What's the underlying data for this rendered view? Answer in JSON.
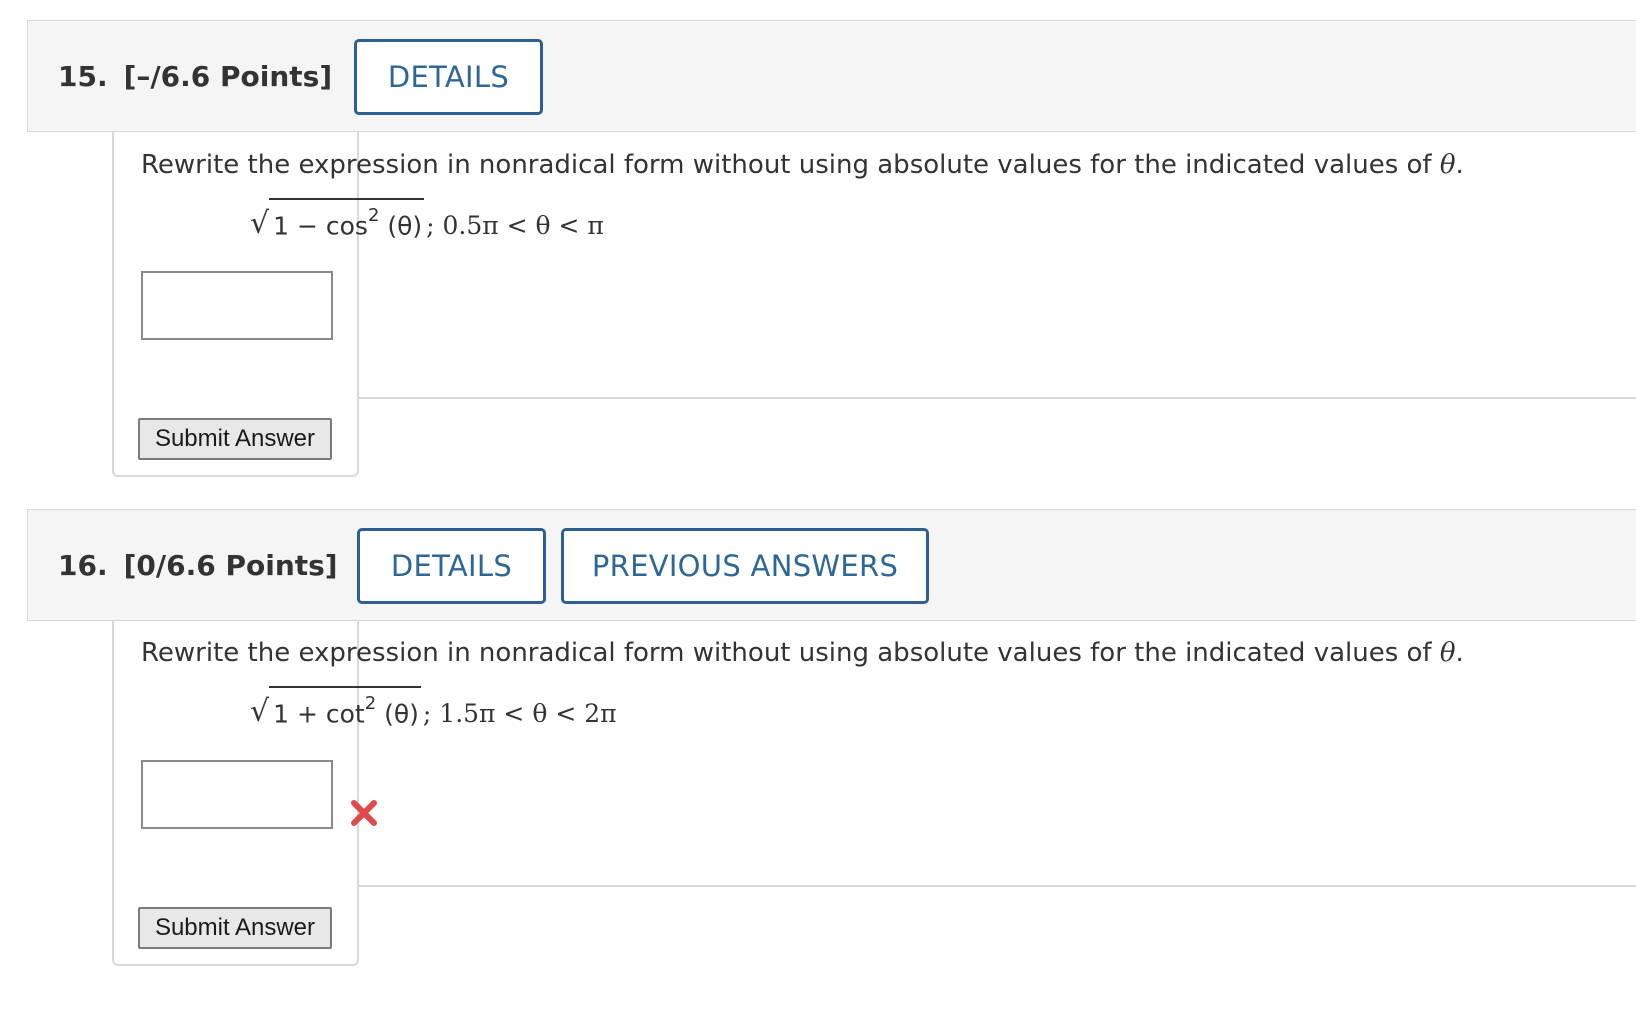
{
  "questions": [
    {
      "number": "15.",
      "points": "[–/6.6 Points]",
      "details_label": "DETAILS",
      "prompt_text": "Rewrite the expression in nonradical form without using absolute values for the indicated values of ",
      "theta": "θ",
      "prompt_end": ".",
      "radicand_lead": "1 − cos",
      "exponent": "2",
      "radicand_tail": " (θ)",
      "constraint": "; 0.5π < θ < π",
      "answer_value": "",
      "submit_label": "Submit Answer"
    },
    {
      "number": "16.",
      "points": "[0/6.6 Points]",
      "details_label": "DETAILS",
      "previous_answers_label": "PREVIOUS ANSWERS",
      "prompt_text": "Rewrite the expression in nonradical form without using absolute values for the indicated values of ",
      "theta": "θ",
      "prompt_end": ".",
      "radicand_lead": "1 + cot",
      "exponent": "2",
      "radicand_tail": " (θ)",
      "constraint": "; 1.5π < θ < 2π",
      "answer_value": "",
      "answer_status_icon": "incorrect-x-icon",
      "submit_label": "Submit Answer"
    }
  ],
  "colors": {
    "accent": "#2e6796",
    "header_bg": "#f5f5f5",
    "border": "#d9d9d9",
    "incorrect": "#e04a4a"
  }
}
